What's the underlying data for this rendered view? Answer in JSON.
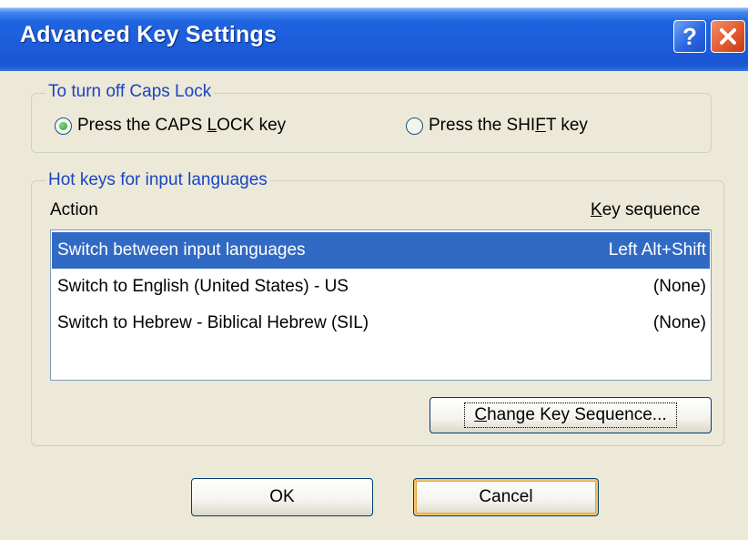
{
  "window": {
    "title": "Advanced Key Settings",
    "help_label": "?",
    "close_icon": "close-x-icon"
  },
  "caps_lock_group": {
    "legend": "To turn off Caps Lock",
    "options": [
      {
        "pre": "Press the CAPS ",
        "accel": "L",
        "post": "OCK key",
        "selected": true
      },
      {
        "pre": "Press the SHI",
        "accel": "F",
        "post": "T key",
        "selected": false
      }
    ]
  },
  "hotkeys_group": {
    "legend": "Hot keys for input languages",
    "columns": {
      "action": "Action",
      "key_sequence_accel": "K",
      "key_sequence_rest": "ey sequence"
    },
    "rows": [
      {
        "action": "Switch between input languages",
        "keys": "Left Alt+Shift",
        "selected": true
      },
      {
        "action": "Switch to English (United States) - US",
        "keys": "(None)",
        "selected": false
      },
      {
        "action": "Switch to Hebrew - Biblical Hebrew (SIL)",
        "keys": "(None)",
        "selected": false
      }
    ],
    "change_button": {
      "accel": "C",
      "rest": "hange Key Sequence..."
    }
  },
  "footer": {
    "ok_label": "OK",
    "cancel_label": "Cancel"
  },
  "colors": {
    "title_bar": "#1c5ad8",
    "legend_text": "#1b44c4",
    "selection": "#316ac5",
    "dialog_bg": "#ece9d8"
  }
}
